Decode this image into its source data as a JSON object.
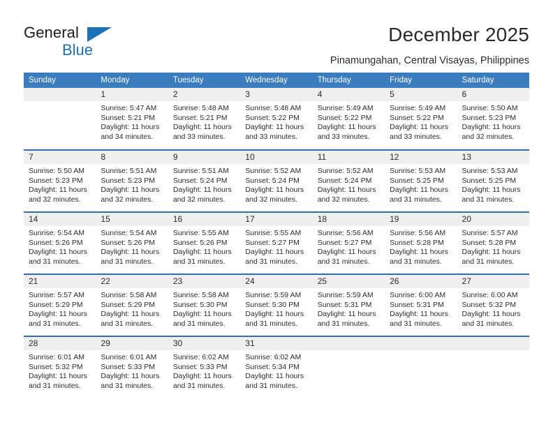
{
  "brand": {
    "line1": "General",
    "line2": "Blue",
    "triangle_icon": "triangle-logo-icon",
    "accent_color": "#1b72b8"
  },
  "header": {
    "title": "December 2025",
    "subtitle": "Pinamungahan, Central Visayas, Philippines"
  },
  "calendar": {
    "header_bg": "#3a7cbe",
    "row_divider_color": "#2f6fb0",
    "daynum_bg": "#efefef",
    "weekdays": [
      "Sunday",
      "Monday",
      "Tuesday",
      "Wednesday",
      "Thursday",
      "Friday",
      "Saturday"
    ],
    "weeks": [
      [
        {
          "day": "",
          "sunrise": "",
          "sunset": "",
          "daylight1": "",
          "daylight2": ""
        },
        {
          "day": "1",
          "sunrise": "Sunrise: 5:47 AM",
          "sunset": "Sunset: 5:21 PM",
          "daylight1": "Daylight: 11 hours",
          "daylight2": "and 34 minutes."
        },
        {
          "day": "2",
          "sunrise": "Sunrise: 5:48 AM",
          "sunset": "Sunset: 5:21 PM",
          "daylight1": "Daylight: 11 hours",
          "daylight2": "and 33 minutes."
        },
        {
          "day": "3",
          "sunrise": "Sunrise: 5:48 AM",
          "sunset": "Sunset: 5:22 PM",
          "daylight1": "Daylight: 11 hours",
          "daylight2": "and 33 minutes."
        },
        {
          "day": "4",
          "sunrise": "Sunrise: 5:49 AM",
          "sunset": "Sunset: 5:22 PM",
          "daylight1": "Daylight: 11 hours",
          "daylight2": "and 33 minutes."
        },
        {
          "day": "5",
          "sunrise": "Sunrise: 5:49 AM",
          "sunset": "Sunset: 5:22 PM",
          "daylight1": "Daylight: 11 hours",
          "daylight2": "and 33 minutes."
        },
        {
          "day": "6",
          "sunrise": "Sunrise: 5:50 AM",
          "sunset": "Sunset: 5:23 PM",
          "daylight1": "Daylight: 11 hours",
          "daylight2": "and 32 minutes."
        }
      ],
      [
        {
          "day": "7",
          "sunrise": "Sunrise: 5:50 AM",
          "sunset": "Sunset: 5:23 PM",
          "daylight1": "Daylight: 11 hours",
          "daylight2": "and 32 minutes."
        },
        {
          "day": "8",
          "sunrise": "Sunrise: 5:51 AM",
          "sunset": "Sunset: 5:23 PM",
          "daylight1": "Daylight: 11 hours",
          "daylight2": "and 32 minutes."
        },
        {
          "day": "9",
          "sunrise": "Sunrise: 5:51 AM",
          "sunset": "Sunset: 5:24 PM",
          "daylight1": "Daylight: 11 hours",
          "daylight2": "and 32 minutes."
        },
        {
          "day": "10",
          "sunrise": "Sunrise: 5:52 AM",
          "sunset": "Sunset: 5:24 PM",
          "daylight1": "Daylight: 11 hours",
          "daylight2": "and 32 minutes."
        },
        {
          "day": "11",
          "sunrise": "Sunrise: 5:52 AM",
          "sunset": "Sunset: 5:24 PM",
          "daylight1": "Daylight: 11 hours",
          "daylight2": "and 32 minutes."
        },
        {
          "day": "12",
          "sunrise": "Sunrise: 5:53 AM",
          "sunset": "Sunset: 5:25 PM",
          "daylight1": "Daylight: 11 hours",
          "daylight2": "and 31 minutes."
        },
        {
          "day": "13",
          "sunrise": "Sunrise: 5:53 AM",
          "sunset": "Sunset: 5:25 PM",
          "daylight1": "Daylight: 11 hours",
          "daylight2": "and 31 minutes."
        }
      ],
      [
        {
          "day": "14",
          "sunrise": "Sunrise: 5:54 AM",
          "sunset": "Sunset: 5:26 PM",
          "daylight1": "Daylight: 11 hours",
          "daylight2": "and 31 minutes."
        },
        {
          "day": "15",
          "sunrise": "Sunrise: 5:54 AM",
          "sunset": "Sunset: 5:26 PM",
          "daylight1": "Daylight: 11 hours",
          "daylight2": "and 31 minutes."
        },
        {
          "day": "16",
          "sunrise": "Sunrise: 5:55 AM",
          "sunset": "Sunset: 5:26 PM",
          "daylight1": "Daylight: 11 hours",
          "daylight2": "and 31 minutes."
        },
        {
          "day": "17",
          "sunrise": "Sunrise: 5:55 AM",
          "sunset": "Sunset: 5:27 PM",
          "daylight1": "Daylight: 11 hours",
          "daylight2": "and 31 minutes."
        },
        {
          "day": "18",
          "sunrise": "Sunrise: 5:56 AM",
          "sunset": "Sunset: 5:27 PM",
          "daylight1": "Daylight: 11 hours",
          "daylight2": "and 31 minutes."
        },
        {
          "day": "19",
          "sunrise": "Sunrise: 5:56 AM",
          "sunset": "Sunset: 5:28 PM",
          "daylight1": "Daylight: 11 hours",
          "daylight2": "and 31 minutes."
        },
        {
          "day": "20",
          "sunrise": "Sunrise: 5:57 AM",
          "sunset": "Sunset: 5:28 PM",
          "daylight1": "Daylight: 11 hours",
          "daylight2": "and 31 minutes."
        }
      ],
      [
        {
          "day": "21",
          "sunrise": "Sunrise: 5:57 AM",
          "sunset": "Sunset: 5:29 PM",
          "daylight1": "Daylight: 11 hours",
          "daylight2": "and 31 minutes."
        },
        {
          "day": "22",
          "sunrise": "Sunrise: 5:58 AM",
          "sunset": "Sunset: 5:29 PM",
          "daylight1": "Daylight: 11 hours",
          "daylight2": "and 31 minutes."
        },
        {
          "day": "23",
          "sunrise": "Sunrise: 5:58 AM",
          "sunset": "Sunset: 5:30 PM",
          "daylight1": "Daylight: 11 hours",
          "daylight2": "and 31 minutes."
        },
        {
          "day": "24",
          "sunrise": "Sunrise: 5:59 AM",
          "sunset": "Sunset: 5:30 PM",
          "daylight1": "Daylight: 11 hours",
          "daylight2": "and 31 minutes."
        },
        {
          "day": "25",
          "sunrise": "Sunrise: 5:59 AM",
          "sunset": "Sunset: 5:31 PM",
          "daylight1": "Daylight: 11 hours",
          "daylight2": "and 31 minutes."
        },
        {
          "day": "26",
          "sunrise": "Sunrise: 6:00 AM",
          "sunset": "Sunset: 5:31 PM",
          "daylight1": "Daylight: 11 hours",
          "daylight2": "and 31 minutes."
        },
        {
          "day": "27",
          "sunrise": "Sunrise: 6:00 AM",
          "sunset": "Sunset: 5:32 PM",
          "daylight1": "Daylight: 11 hours",
          "daylight2": "and 31 minutes."
        }
      ],
      [
        {
          "day": "28",
          "sunrise": "Sunrise: 6:01 AM",
          "sunset": "Sunset: 5:32 PM",
          "daylight1": "Daylight: 11 hours",
          "daylight2": "and 31 minutes."
        },
        {
          "day": "29",
          "sunrise": "Sunrise: 6:01 AM",
          "sunset": "Sunset: 5:33 PM",
          "daylight1": "Daylight: 11 hours",
          "daylight2": "and 31 minutes."
        },
        {
          "day": "30",
          "sunrise": "Sunrise: 6:02 AM",
          "sunset": "Sunset: 5:33 PM",
          "daylight1": "Daylight: 11 hours",
          "daylight2": "and 31 minutes."
        },
        {
          "day": "31",
          "sunrise": "Sunrise: 6:02 AM",
          "sunset": "Sunset: 5:34 PM",
          "daylight1": "Daylight: 11 hours",
          "daylight2": "and 31 minutes."
        },
        {
          "day": "",
          "sunrise": "",
          "sunset": "",
          "daylight1": "",
          "daylight2": ""
        },
        {
          "day": "",
          "sunrise": "",
          "sunset": "",
          "daylight1": "",
          "daylight2": ""
        },
        {
          "day": "",
          "sunrise": "",
          "sunset": "",
          "daylight1": "",
          "daylight2": ""
        }
      ]
    ]
  }
}
